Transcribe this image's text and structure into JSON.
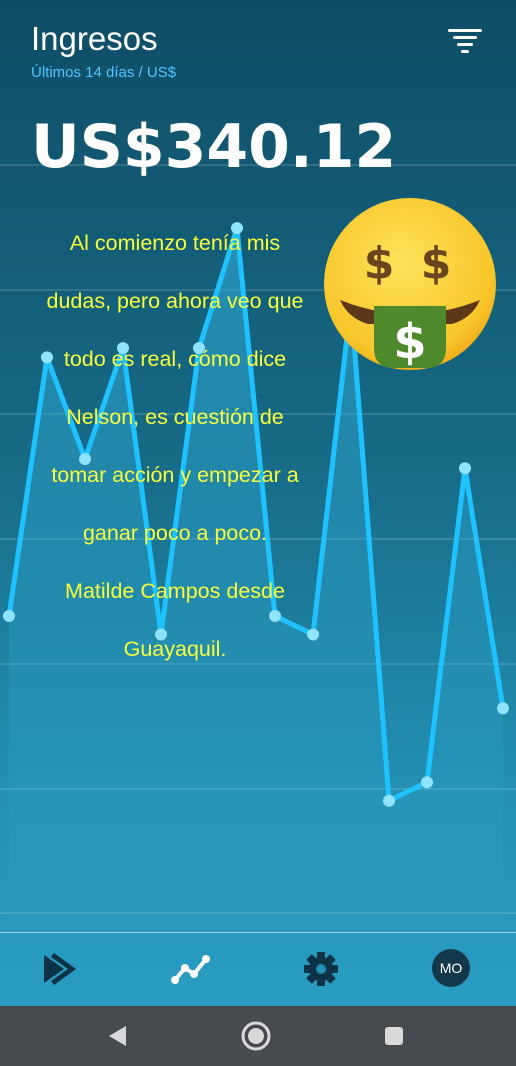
{
  "header": {
    "title": "Ingresos",
    "subtitle": "Últimos 14 días / US$",
    "filter_icon": "filter-list-icon"
  },
  "summary": {
    "amount": "US$340.12"
  },
  "testimonial": {
    "text": "Al comienzo tenía mis dudas, pero ahora veo que todo es real, cómo dice Nelson, es cuestión de tomar acción y empezar a ganar poco a poco. Matilde Campos desde Guayaquil.",
    "lines": [
      "Al comienzo tenía mis",
      "dudas, pero ahora veo que",
      "todo es real, cómo dice",
      "Nelson, es cuestión de",
      "tomar acción y empezar a",
      "ganar poco a poco.",
      "Matilde Campos desde",
      "Guayaquil."
    ]
  },
  "emoji": {
    "icon": "money-mouth-face-icon",
    "symbols": [
      "$",
      "$",
      "$"
    ]
  },
  "chart_data": {
    "type": "line",
    "x": [
      1,
      2,
      3,
      4,
      5,
      6,
      7,
      8,
      9,
      10,
      11,
      12,
      13,
      14
    ],
    "y": [
      34,
      62,
      51,
      63,
      32,
      63,
      76,
      34,
      32,
      68,
      14,
      16,
      50,
      24
    ],
    "ylim": [
      0,
      85
    ],
    "grid": true,
    "line_color": "#1ec2ff",
    "point_color": "#8fe3ff"
  },
  "bottom_nav": {
    "items": [
      {
        "name": "logo",
        "icon": "play-arrows-logo-icon"
      },
      {
        "name": "stats",
        "icon": "trending-chart-icon"
      },
      {
        "name": "settings",
        "icon": "gear-icon"
      }
    ],
    "avatar_initials": "MO"
  },
  "system_nav": {
    "back_icon": "back-triangle-icon",
    "home_icon": "home-circle-icon",
    "recent_icon": "recent-square-icon"
  },
  "colors": {
    "accent": "#4fc4ff",
    "highlight_text": "#f7ff3a",
    "avatar_bg": "#12384a",
    "system_bar": "#464a4e"
  }
}
